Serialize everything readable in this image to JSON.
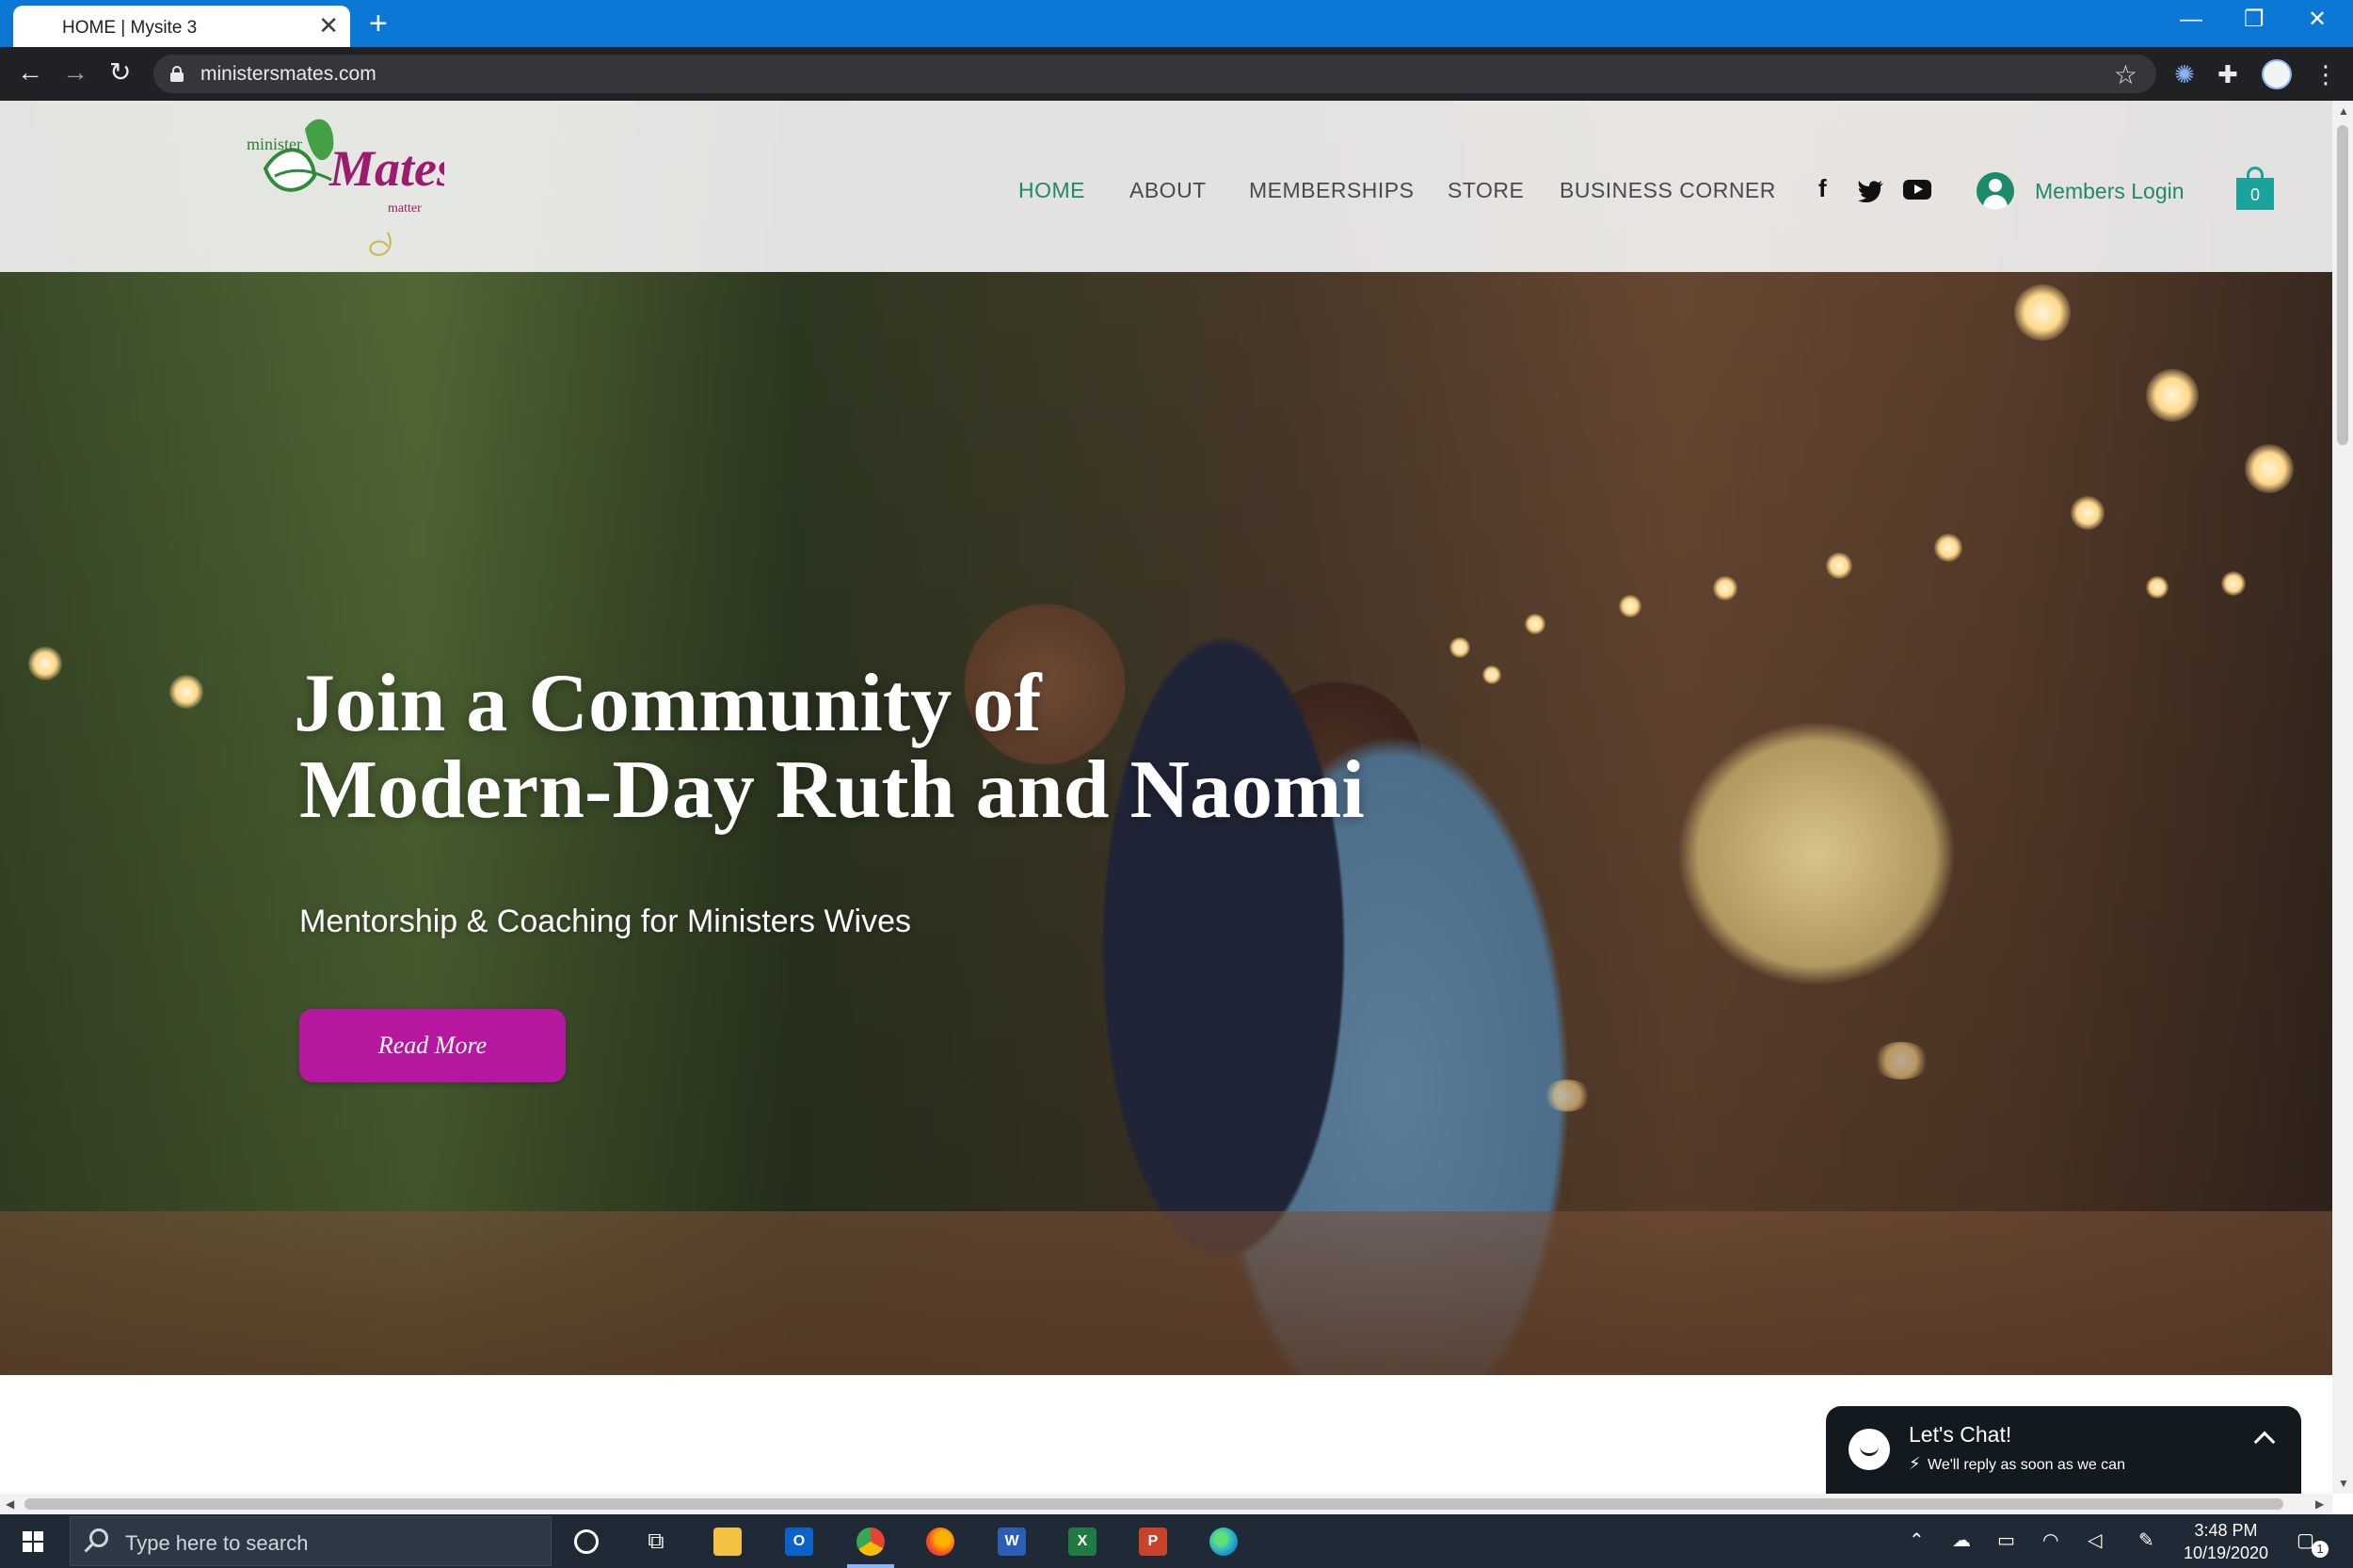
{
  "browser": {
    "tab_title": "HOME | Mysite 3",
    "tab_close": "✕",
    "new_tab": "+",
    "url": "ministersmates.com",
    "window_controls": {
      "minimize": "—",
      "restore": "❐",
      "close": "✕"
    }
  },
  "site": {
    "logo": {
      "small_text": "minister",
      "brand": "Mates",
      "tagline": "matter"
    },
    "nav": [
      "HOME",
      "ABOUT",
      "MEMBERSHIPS",
      "STORE",
      "BUSINESS CORNER"
    ],
    "members_login": "Members Login",
    "cart_count": "0",
    "accent_color": "#1f8a6a",
    "button_color": "#b5179e"
  },
  "hero": {
    "title_line1": "Join a Community of",
    "title_line2": "Modern-Day Ruth and Naomi",
    "subtitle": "Mentorship & Coaching for Ministers Wives",
    "cta": "Read More"
  },
  "chat": {
    "title": "Let's Chat!",
    "subtitle": "We'll reply as soon as we can"
  },
  "taskbar": {
    "search_placeholder": "Type here to search",
    "time": "3:48 PM",
    "date": "10/19/2020",
    "notification_count": "1"
  }
}
